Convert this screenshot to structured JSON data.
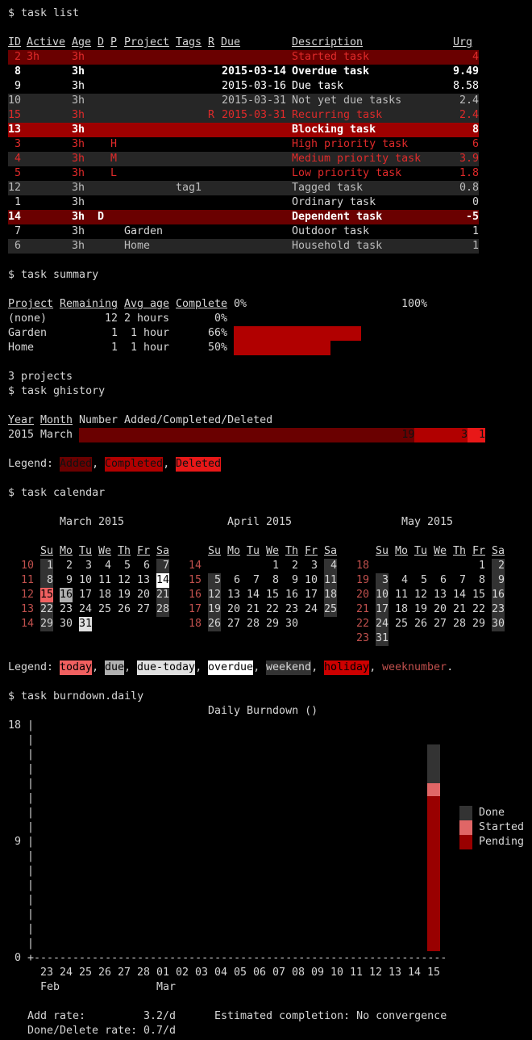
{
  "colors": {
    "row_red_bg": "#6a0000",
    "row_blocking_bg": "#9e0000",
    "row_alt_bg": "#262626",
    "accent_red": "#e02a2a",
    "summary_bar": "#b10000",
    "hist_added": "#6a0000",
    "hist_completed": "#b10000",
    "hist_deleted": "#e81818",
    "weekend_bg": "#333333",
    "today_bg": "#f06060",
    "due_bg": "#b0b0b0",
    "due_today_bg": "#e0e0e0",
    "overdue_bg": "#ffffff",
    "holiday_bg": "#cc0000",
    "burn_done": "#333333",
    "burn_started": "#e06666",
    "burn_pending": "#990000"
  },
  "commands": {
    "list": "$ task list",
    "summary": "$ task summary",
    "ghistory": "$ task ghistory",
    "calendar": "$ task calendar",
    "burndown": "$ task burndown.daily"
  },
  "task_list": {
    "headers": [
      "ID",
      "Active",
      "Age",
      "D",
      "P",
      "Project",
      "Tags",
      "R",
      "Due",
      "Description",
      "Urg"
    ],
    "rows": [
      {
        "id": "2",
        "active": "3h",
        "age": "3h",
        "d": "",
        "p": "",
        "project": "",
        "tags": "",
        "r": "",
        "due": "",
        "desc": "Started task",
        "urg": "4",
        "style": "started"
      },
      {
        "id": "8",
        "active": "",
        "age": "3h",
        "d": "",
        "p": "",
        "project": "",
        "tags": "",
        "r": "",
        "due": "2015-03-14",
        "desc": "Overdue task",
        "urg": "9.49",
        "style": "overdue"
      },
      {
        "id": "9",
        "active": "",
        "age": "3h",
        "d": "",
        "p": "",
        "project": "",
        "tags": "",
        "r": "",
        "due": "2015-03-16",
        "desc": "Due task",
        "urg": "8.58",
        "style": "due"
      },
      {
        "id": "10",
        "active": "",
        "age": "3h",
        "d": "",
        "p": "",
        "project": "",
        "tags": "",
        "r": "",
        "due": "2015-03-31",
        "desc": "Not yet due tasks",
        "urg": "2.4",
        "style": "alt"
      },
      {
        "id": "15",
        "active": "",
        "age": "3h",
        "d": "",
        "p": "",
        "project": "",
        "tags": "",
        "r": "R",
        "due": "2015-03-31",
        "desc": "Recurring task",
        "urg": "2.4",
        "style": "recur"
      },
      {
        "id": "13",
        "active": "",
        "age": "3h",
        "d": "",
        "p": "",
        "project": "",
        "tags": "",
        "r": "",
        "due": "",
        "desc": "Blocking task",
        "urg": "8",
        "style": "blocking"
      },
      {
        "id": "3",
        "active": "",
        "age": "3h",
        "d": "",
        "p": "H",
        "project": "",
        "tags": "",
        "r": "",
        "due": "",
        "desc": "High priority task",
        "urg": "6",
        "style": "high"
      },
      {
        "id": "4",
        "active": "",
        "age": "3h",
        "d": "",
        "p": "M",
        "project": "",
        "tags": "",
        "r": "",
        "due": "",
        "desc": "Medium priority task",
        "urg": "3.9",
        "style": "medium"
      },
      {
        "id": "5",
        "active": "",
        "age": "3h",
        "d": "",
        "p": "L",
        "project": "",
        "tags": "",
        "r": "",
        "due": "",
        "desc": "Low priority task",
        "urg": "1.8",
        "style": "low"
      },
      {
        "id": "12",
        "active": "",
        "age": "3h",
        "d": "",
        "p": "",
        "project": "",
        "tags": "tag1",
        "r": "",
        "due": "",
        "desc": "Tagged task",
        "urg": "0.8",
        "style": "alt"
      },
      {
        "id": "1",
        "active": "",
        "age": "3h",
        "d": "",
        "p": "",
        "project": "",
        "tags": "",
        "r": "",
        "due": "",
        "desc": "Ordinary task",
        "urg": "0",
        "style": "plain"
      },
      {
        "id": "14",
        "active": "",
        "age": "3h",
        "d": "D",
        "p": "",
        "project": "",
        "tags": "",
        "r": "",
        "due": "",
        "desc": "Dependent task",
        "urg": "-5",
        "style": "dependent"
      },
      {
        "id": "7",
        "active": "",
        "age": "3h",
        "d": "",
        "p": "",
        "project": "Garden",
        "tags": "",
        "r": "",
        "due": "",
        "desc": "Outdoor task",
        "urg": "1",
        "style": "plain"
      },
      {
        "id": "6",
        "active": "",
        "age": "3h",
        "d": "",
        "p": "",
        "project": "Home",
        "tags": "",
        "r": "",
        "due": "",
        "desc": "Household task",
        "urg": "1",
        "style": "alt"
      }
    ]
  },
  "summary": {
    "headers": [
      "Project",
      "Remaining",
      "Avg age",
      "Complete"
    ],
    "scale_0": "0%",
    "scale_100": "100%",
    "rows": [
      {
        "project": "(none)",
        "remaining": "12",
        "avg_age": "2 hours",
        "complete": "0%",
        "fraction": 0
      },
      {
        "project": "Garden",
        "remaining": "1",
        "avg_age": "1 hour",
        "complete": "66%",
        "fraction": 0.66
      },
      {
        "project": "Home",
        "remaining": "1",
        "avg_age": "1 hour",
        "complete": "50%",
        "fraction": 0.5
      }
    ],
    "footer": "3 projects"
  },
  "ghistory": {
    "headers": [
      "Year",
      "Month",
      "Number Added/Completed/Deleted"
    ],
    "row": {
      "year": "2015",
      "month": "March",
      "added": 19,
      "completed": 3,
      "deleted": 1,
      "added_label": "19",
      "completed_label": "3",
      "deleted_label": "1"
    },
    "legend_label": "Legend:",
    "legend": [
      "Added",
      "Completed",
      "Deleted"
    ]
  },
  "calendar": {
    "day_headers": [
      "Su",
      "Mo",
      "Tu",
      "We",
      "Th",
      "Fr",
      "Sa"
    ],
    "months": [
      {
        "title": "March 2015",
        "weeks": [
          {
            "wn": "10",
            "days": [
              "1",
              "2",
              "3",
              "4",
              "5",
              "6",
              "7"
            ]
          },
          {
            "wn": "11",
            "days": [
              "8",
              "9",
              "10",
              "11",
              "12",
              "13",
              "14"
            ]
          },
          {
            "wn": "12",
            "days": [
              "15",
              "16",
              "17",
              "18",
              "19",
              "20",
              "21"
            ]
          },
          {
            "wn": "13",
            "days": [
              "22",
              "23",
              "24",
              "25",
              "26",
              "27",
              "28"
            ]
          },
          {
            "wn": "14",
            "days": [
              "29",
              "30",
              "31",
              "",
              "",
              "",
              ""
            ]
          }
        ]
      },
      {
        "title": "April 2015",
        "weeks": [
          {
            "wn": "14",
            "days": [
              "",
              "",
              "",
              "1",
              "2",
              "3",
              "4"
            ]
          },
          {
            "wn": "15",
            "days": [
              "5",
              "6",
              "7",
              "8",
              "9",
              "10",
              "11"
            ]
          },
          {
            "wn": "16",
            "days": [
              "12",
              "13",
              "14",
              "15",
              "16",
              "17",
              "18"
            ]
          },
          {
            "wn": "17",
            "days": [
              "19",
              "20",
              "21",
              "22",
              "23",
              "24",
              "25"
            ]
          },
          {
            "wn": "18",
            "days": [
              "26",
              "27",
              "28",
              "29",
              "30",
              "",
              ""
            ]
          }
        ]
      },
      {
        "title": "May 2015",
        "weeks": [
          {
            "wn": "18",
            "days": [
              "",
              "",
              "",
              "",
              "",
              "1",
              "2"
            ]
          },
          {
            "wn": "19",
            "days": [
              "3",
              "4",
              "5",
              "6",
              "7",
              "8",
              "9"
            ]
          },
          {
            "wn": "20",
            "days": [
              "10",
              "11",
              "12",
              "13",
              "14",
              "15",
              "16"
            ]
          },
          {
            "wn": "21",
            "days": [
              "17",
              "18",
              "19",
              "20",
              "21",
              "22",
              "23"
            ]
          },
          {
            "wn": "22",
            "days": [
              "24",
              "25",
              "26",
              "27",
              "28",
              "29",
              "30"
            ]
          },
          {
            "wn": "23",
            "days": [
              "31",
              "",
              "",
              "",
              "",
              "",
              ""
            ]
          }
        ]
      }
    ],
    "legend_label": "Legend:",
    "legend": [
      "today",
      "due",
      "due-today",
      "overdue",
      "weekend",
      "holiday",
      "weeknumber"
    ]
  },
  "burndown": {
    "title": "Daily Burndown ()",
    "y_ticks": [
      "18",
      "9",
      "0"
    ],
    "x_days": [
      "23",
      "24",
      "25",
      "26",
      "27",
      "28",
      "01",
      "02",
      "03",
      "04",
      "05",
      "06",
      "07",
      "08",
      "09",
      "10",
      "11",
      "12",
      "13",
      "14",
      "15"
    ],
    "x_months": [
      "Feb",
      "Mar"
    ],
    "legend": [
      "Done",
      "Started",
      "Pending"
    ],
    "chart_data": {
      "type": "bar",
      "categories": [
        "23",
        "24",
        "25",
        "26",
        "27",
        "28",
        "01",
        "02",
        "03",
        "04",
        "05",
        "06",
        "07",
        "08",
        "09",
        "10",
        "11",
        "12",
        "13",
        "14",
        "15"
      ],
      "series": [
        {
          "name": "Pending",
          "values": [
            0,
            0,
            0,
            0,
            0,
            0,
            0,
            0,
            0,
            0,
            0,
            0,
            0,
            0,
            0,
            0,
            0,
            0,
            0,
            0,
            12
          ]
        },
        {
          "name": "Started",
          "values": [
            0,
            0,
            0,
            0,
            0,
            0,
            0,
            0,
            0,
            0,
            0,
            0,
            0,
            0,
            0,
            0,
            0,
            0,
            0,
            0,
            1
          ]
        },
        {
          "name": "Done",
          "values": [
            0,
            0,
            0,
            0,
            0,
            0,
            0,
            0,
            0,
            0,
            0,
            0,
            0,
            0,
            0,
            0,
            0,
            0,
            0,
            0,
            3
          ]
        }
      ],
      "ylim": [
        0,
        18
      ]
    },
    "stats": {
      "add_rate_label": "Add rate:",
      "add_rate": "3.2/d",
      "done_rate_label": "Done/Delete rate:",
      "done_rate": "0.7/d",
      "estimate": "Estimated completion: No convergence"
    }
  }
}
